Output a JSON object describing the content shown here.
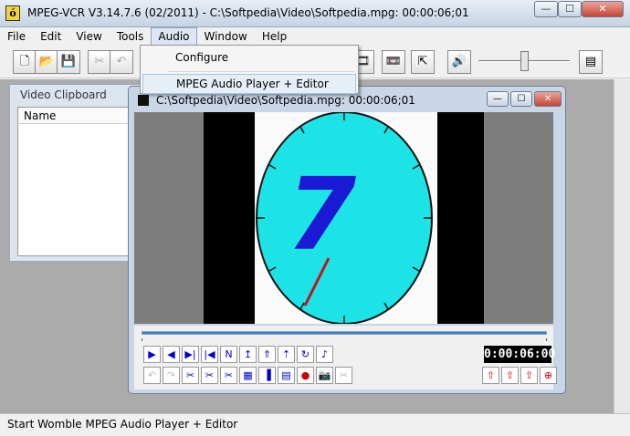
{
  "window": {
    "icon_letter": "ó",
    "title": "MPEG-VCR V3.14.7.6 (02/2011) - C:\\Softpedia\\Video\\Softpedia.mpg: 00:00:06;01",
    "minimize": "—",
    "maximize": "☐",
    "close": "✕"
  },
  "menu": [
    {
      "label": "File"
    },
    {
      "label": "Edit"
    },
    {
      "label": "View"
    },
    {
      "label": "Tools"
    },
    {
      "label": "Audio"
    },
    {
      "label": "Window"
    },
    {
      "label": "Help"
    }
  ],
  "toolbar": {
    "new": "🗋",
    "open": "📂",
    "save": "💾",
    "cut": "✂",
    "undo": "↶",
    "film": "🎞",
    "record": "📼",
    "export": "⇱",
    "speaker": "🔊",
    "mixer": "▤"
  },
  "audio_menu": {
    "items": [
      {
        "label": "Configure"
      },
      {
        "label": "MPEG Audio Player + Editor"
      }
    ]
  },
  "clipboard": {
    "title": "Video Clipboard",
    "column_name": "Name"
  },
  "player": {
    "title": "C:\\Softpedia\\Video\\Softpedia.mpg: 00:00:06;01",
    "frame_digit": "7",
    "timecode": "0:00:06:00",
    "minimize": "—",
    "maximize": "☐",
    "close": "✕",
    "transport": [
      "▶",
      "◀",
      "▶|",
      "|◀",
      "N",
      "↥",
      "⇑",
      "⇡",
      "↻",
      "♪"
    ],
    "edit_row": [
      "↶",
      "↷",
      "✂",
      "✂",
      "✂",
      "▦",
      "▐",
      "▤",
      "●",
      "📷",
      "✂"
    ],
    "marks": [
      "⇧",
      "⇧",
      "⇧",
      "⊕"
    ]
  },
  "status": {
    "text": "Start Womble MPEG Audio Player + Editor"
  },
  "colors": {
    "clock_face": "#1ce3e6",
    "digit": "#1a1ad4",
    "hand": "#c0141e",
    "video_bg": "#7d7d7d",
    "timecode_bg": "#000000"
  }
}
